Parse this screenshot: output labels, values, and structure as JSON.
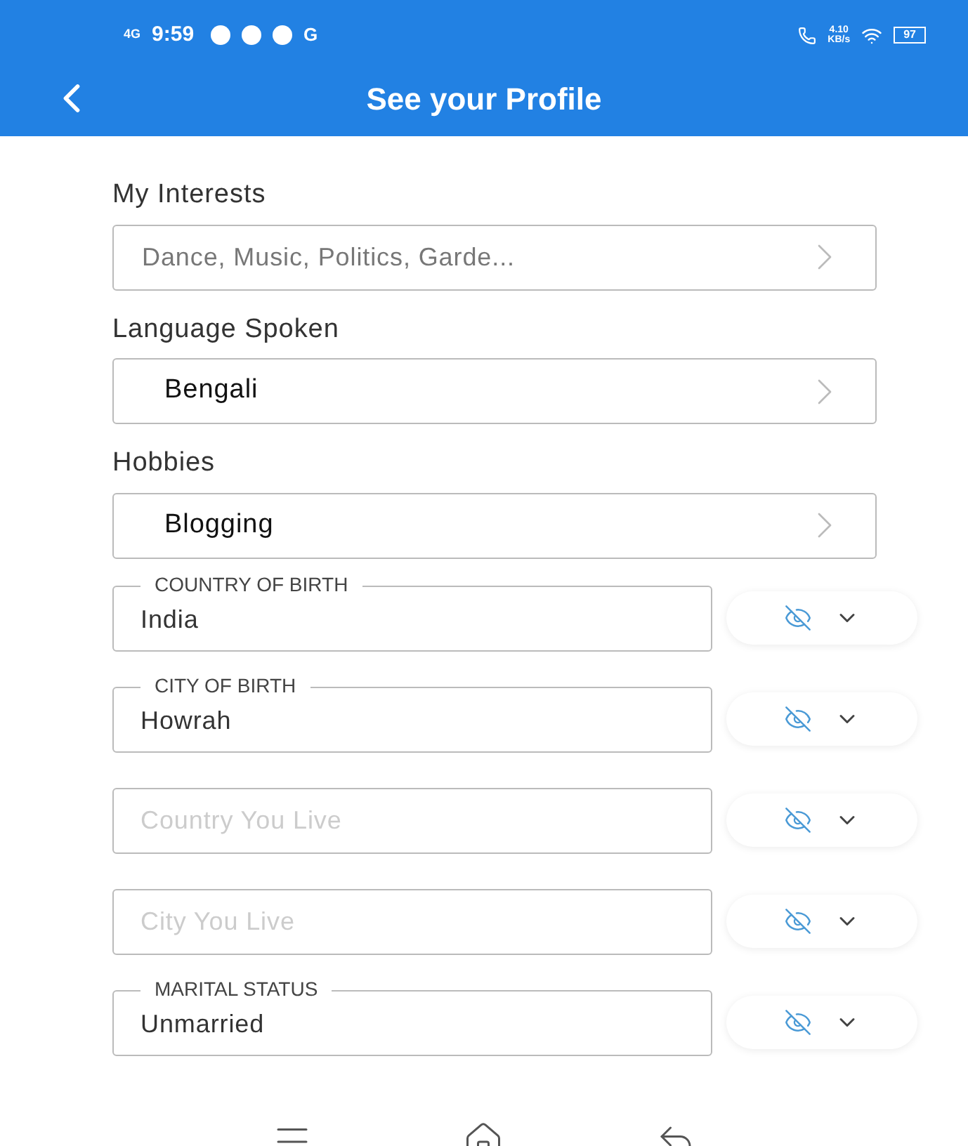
{
  "status_bar": {
    "network": "4G",
    "time": "9:59",
    "notification_letter": "G",
    "speed": "4.10",
    "speed_unit": "KB/s",
    "battery": "97"
  },
  "header": {
    "title": "See your Profile"
  },
  "selectors": [
    {
      "label": "My Interests",
      "value": "Dance, Music, Politics, Garde...",
      "kind": "summary"
    },
    {
      "label": "Language Spoken",
      "value": "Bengali",
      "kind": "choice"
    },
    {
      "label": "Hobbies",
      "value": "Blogging",
      "kind": "choice"
    }
  ],
  "fields": [
    {
      "label": "COUNTRY OF BIRTH",
      "value": "India",
      "visible": false
    },
    {
      "label": "CITY OF BIRTH",
      "value": "Howrah",
      "visible": false
    },
    {
      "placeholder": "Country You Live",
      "visible": false
    },
    {
      "placeholder": "City You Live",
      "visible": false
    },
    {
      "label": "MARITAL STATUS",
      "value": "Unmarried",
      "visible": false
    }
  ]
}
